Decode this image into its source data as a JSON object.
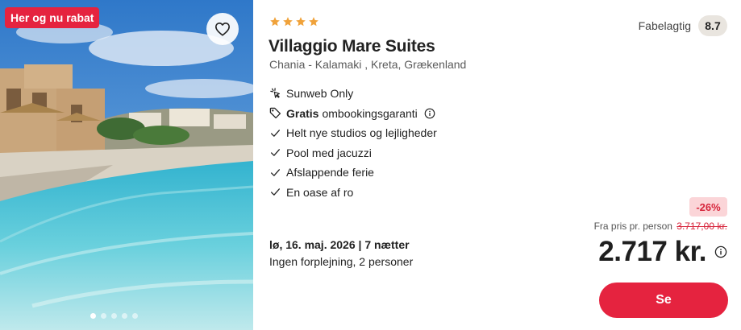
{
  "photo": {
    "badge": "Her og nu rabat",
    "favorite_icon": "heart-outline-icon",
    "slide_count": 5,
    "active_slide": 1
  },
  "hotel": {
    "stars": 4,
    "star_color": "#f0a23a",
    "name": "Villaggio Mare Suites",
    "location": "Chania - Kalamaki , Kreta, Grækenland"
  },
  "rating": {
    "label": "Fabelagtig",
    "score": "8.7"
  },
  "features": {
    "sunweb_only": "Sunweb Only",
    "gratis_bold": "Gratis",
    "gratis_rest": "ombookingsgaranti",
    "items": [
      "Helt nye studios og lejligheder",
      "Pool med jacuzzi",
      "Afslappende ferie",
      "En oase af ro"
    ]
  },
  "trip": {
    "date": "lø, 16. maj. 2026 | 7 nætter",
    "board": "Ingen forplejning, 2 personer"
  },
  "price": {
    "discount": "-26%",
    "from_label": "Fra pris pr. person",
    "old_price": "3.717,00 kr.",
    "current": "2.717 kr."
  },
  "cta": {
    "label": "Se"
  },
  "colors": {
    "accent": "#e5233f",
    "discount_bg": "#fbd5d8",
    "rating_bg": "#e9e5df"
  }
}
